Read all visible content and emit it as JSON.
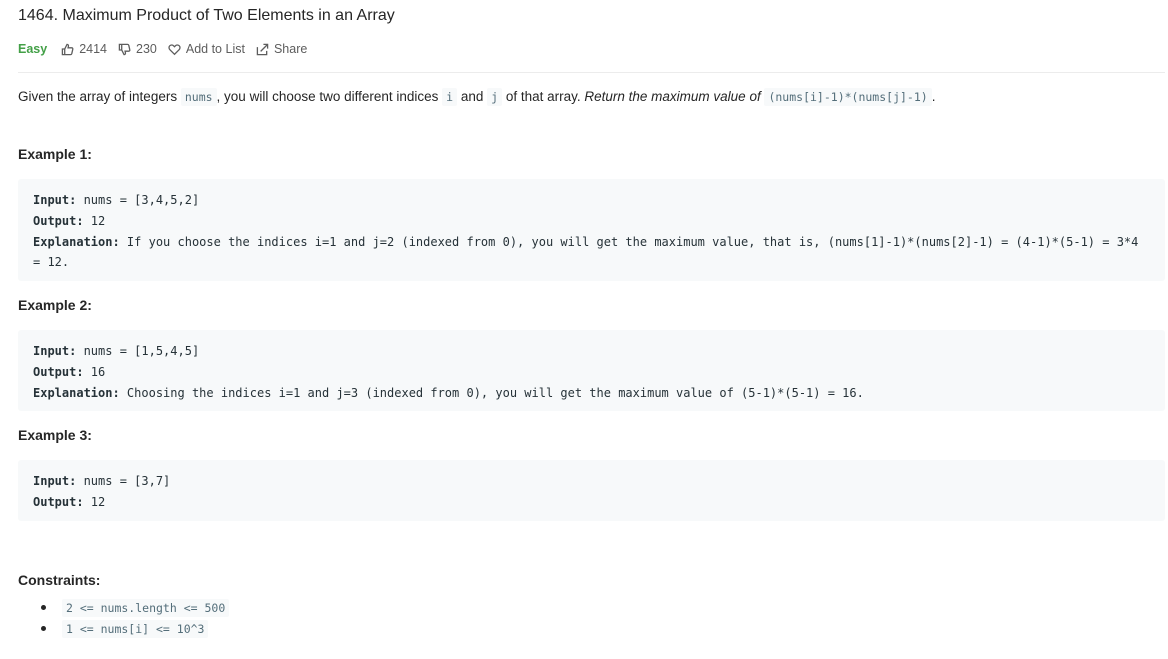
{
  "problem": {
    "title": "1464. Maximum Product of Two Elements in an Array",
    "difficulty": "Easy",
    "likes": "2414",
    "dislikes": "230",
    "add_to_list": "Add to List",
    "share": "Share"
  },
  "description": {
    "part1": "Given the array of integers ",
    "code_nums": "nums",
    "part2": ", you will choose two different indices ",
    "code_i": "i",
    "part3": " and ",
    "code_j": "j",
    "part4": " of that array. ",
    "italic": "Return the maximum value of ",
    "code_expr": "(nums[i]-1)*(nums[j]-1)",
    "part5": "."
  },
  "examples": [
    {
      "heading": "Example 1:",
      "input_label": "Input:",
      "input_value": " nums = [3,4,5,2]",
      "output_label": "Output:",
      "output_value": " 12",
      "explanation_label": "Explanation:",
      "explanation_value": " If you choose the indices i=1 and j=2 (indexed from 0), you will get the maximum value, that is, (nums[1]-1)*(nums[2]-1) = (4-1)*(5-1) = 3*4 = 12."
    },
    {
      "heading": "Example 2:",
      "input_label": "Input:",
      "input_value": " nums = [1,5,4,5]",
      "output_label": "Output:",
      "output_value": " 16",
      "explanation_label": "Explanation:",
      "explanation_value": " Choosing the indices i=1 and j=3 (indexed from 0), you will get the maximum value of (5-1)*(5-1) = 16."
    },
    {
      "heading": "Example 3:",
      "input_label": "Input:",
      "input_value": " nums = [3,7]",
      "output_label": "Output:",
      "output_value": " 12"
    }
  ],
  "constraints": {
    "heading": "Constraints:",
    "items": [
      "2 <= nums.length <= 500",
      "1 <= nums[i] <= 10^3"
    ]
  },
  "colors": {
    "easy": "#43a047",
    "code_bg": "#f7f9fa",
    "code_text": "#546e7a"
  },
  "icons": [
    "thumbs-up-icon",
    "thumbs-down-icon",
    "heart-icon",
    "share-icon"
  ]
}
